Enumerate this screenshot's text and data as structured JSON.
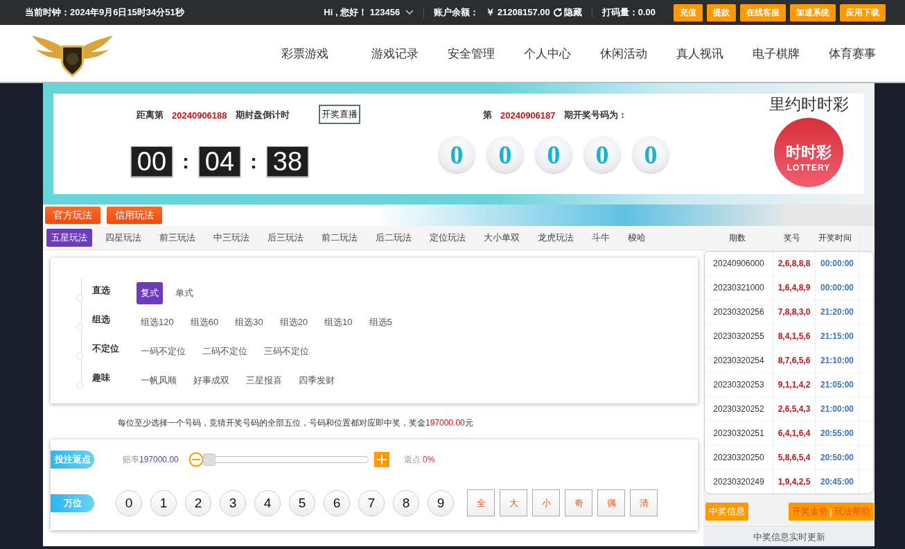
{
  "top_bar": {
    "clock": "当前时钟：2024年9月6日15时34分51秒",
    "greeting": "Hi , 您好！ 123456",
    "balance_label": "账户余额：",
    "balance": "￥ 21208157.00",
    "hide_link": "隐藏",
    "bet_amount": "打码量：0.00",
    "buttons": [
      "充值",
      "提款",
      "在线客服",
      "加速系统",
      "应用下载"
    ]
  },
  "nav": {
    "items": [
      "彩票游戏",
      "游戏记录",
      "安全管理",
      "个人中心",
      "休闲活动",
      "真人视讯",
      "电子棋牌",
      "体育赛事"
    ]
  },
  "draw_panel": {
    "countdown_prefix": "距离第",
    "countdown_issue": "20240906188",
    "countdown_suffix": "期封盘倒计时",
    "live_button": "开奖直播",
    "timer": [
      "00",
      "04",
      "38"
    ],
    "timer_separator": ":",
    "result_prefix": "第",
    "result_issue": "20240906187",
    "result_suffix": "期开奖号码为：",
    "balls": [
      "0",
      "0",
      "0",
      "0",
      "0"
    ],
    "brand_title": "里约时时彩",
    "logo_text": "时时彩",
    "logo_subtext": "LOTTERY"
  },
  "mode_tabs": [
    "官方玩法",
    "信用玩法"
  ],
  "play_tabs": [
    {
      "label": "五星玩法",
      "selected": true
    },
    {
      "label": "四星玩法",
      "selected": false
    },
    {
      "label": "前三玩法",
      "selected": false
    },
    {
      "label": "中三玩法",
      "selected": false
    },
    {
      "label": "后三玩法",
      "selected": false
    },
    {
      "label": "前二玩法",
      "selected": false
    },
    {
      "label": "后二玩法",
      "selected": false
    },
    {
      "label": "定位玩法",
      "selected": false
    },
    {
      "label": "大小单双",
      "selected": false
    },
    {
      "label": "龙虎玩法",
      "selected": false
    },
    {
      "label": "斗牛",
      "selected": false
    },
    {
      "label": "梭哈",
      "selected": false
    }
  ],
  "play_groups": [
    {
      "label": "直选",
      "options": [
        {
          "label": "复式",
          "selected": true
        },
        {
          "label": "单式",
          "selected": false
        }
      ]
    },
    {
      "label": "组选",
      "options": [
        {
          "label": "组选120",
          "selected": false
        },
        {
          "label": "组选60",
          "selected": false
        },
        {
          "label": "组选30",
          "selected": false
        },
        {
          "label": "组选20",
          "selected": false
        },
        {
          "label": "组选10",
          "selected": false
        },
        {
          "label": "组选5",
          "selected": false
        }
      ]
    },
    {
      "label": "不定位",
      "options": [
        {
          "label": "一码不定位",
          "selected": false
        },
        {
          "label": "二码不定位",
          "selected": false
        },
        {
          "label": "三码不定位",
          "selected": false
        }
      ]
    },
    {
      "label": "趣味",
      "options": [
        {
          "label": "一帆风顺",
          "selected": false
        },
        {
          "label": "好事成双",
          "selected": false
        },
        {
          "label": "三星报喜",
          "selected": false
        },
        {
          "label": "四季发财",
          "selected": false
        }
      ]
    }
  ],
  "hint": {
    "text": "每位至少选择一个号码，竞猜开奖号码的全部五位，号码和位置都对应即中奖，奖金",
    "amount": "197000.00",
    "unit": "元"
  },
  "rebate": {
    "label": "投注返点",
    "odds_label": "赔率",
    "odds": "197000.00",
    "level": 0,
    "rebate_label": "返点",
    "rebate_value": "0%"
  },
  "digit_rows": [
    {
      "label": "万位",
      "numbers": [
        "0",
        "1",
        "2",
        "3",
        "4",
        "5",
        "6",
        "7",
        "8",
        "9"
      ],
      "quick": [
        "全",
        "大",
        "小",
        "奇",
        "偶",
        "清"
      ]
    }
  ],
  "history": {
    "columns": [
      "期数",
      "奖号",
      "开奖时间"
    ],
    "rows": [
      {
        "issue": "20240906000",
        "numbers": "2,6,8,8,8",
        "time": "00:00:00"
      },
      {
        "issue": "20230321000",
        "numbers": "1,6,4,8,9",
        "time": "00:00:00"
      },
      {
        "issue": "20230320256",
        "numbers": "7,8,8,3,0",
        "time": "21:20:00"
      },
      {
        "issue": "20230320255",
        "numbers": "8,4,1,5,6",
        "time": "21:15:00"
      },
      {
        "issue": "20230320254",
        "numbers": "8,7,6,5,6",
        "time": "21:10:00"
      },
      {
        "issue": "20230320253",
        "numbers": "9,1,1,4,2",
        "time": "21:05:00"
      },
      {
        "issue": "20230320252",
        "numbers": "2,6,5,4,3",
        "time": "21:00:00"
      },
      {
        "issue": "20230320251",
        "numbers": "6,4,1,6,4",
        "time": "20:55:00"
      },
      {
        "issue": "20230320250",
        "numbers": "5,8,6,5,4",
        "time": "20:50:00"
      },
      {
        "issue": "20230320249",
        "numbers": "1,9,4,2,5",
        "time": "20:45:00"
      }
    ],
    "win_info_button": "中奖信息",
    "trend_link": "开奖走势",
    "link_separator": "|",
    "help_link": "玩法帮助",
    "live_update": "中奖信息实时更新"
  }
}
